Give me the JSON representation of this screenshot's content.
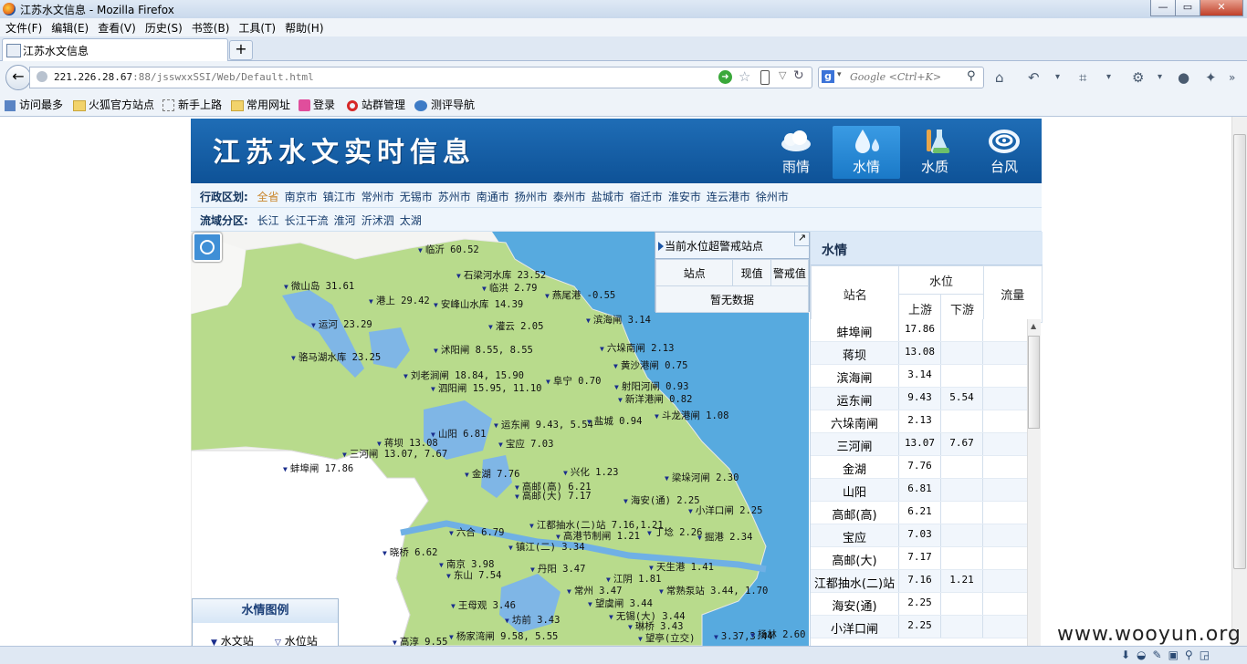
{
  "window": {
    "title": "江苏水文信息 - Mozilla Firefox",
    "min": "—",
    "max": "▭",
    "close": "✕"
  },
  "menu": [
    "文件(F)",
    "编辑(E)",
    "查看(V)",
    "历史(S)",
    "书签(B)",
    "工具(T)",
    "帮助(H)"
  ],
  "tab": {
    "title": "江苏水文信息",
    "new_tab": "+"
  },
  "nav": {
    "url_host": "221.226.28.67",
    "url_rest": ":88/jsswxxSSI/Web/Default.html",
    "search_placeholder": "Google <Ctrl+K>"
  },
  "bookmarks": [
    "访问最多",
    "火狐官方站点",
    "新手上路",
    "常用网址",
    "登录",
    "站群管理",
    "测评导航"
  ],
  "header": {
    "logo": "江苏水文实时信息",
    "nav": [
      {
        "label": "雨情",
        "icon": "cloud-icon"
      },
      {
        "label": "水情",
        "icon": "water-drop-icon"
      },
      {
        "label": "水质",
        "icon": "flask-icon"
      },
      {
        "label": "台风",
        "icon": "typhoon-icon"
      }
    ]
  },
  "region": {
    "label": "行政区划:",
    "items": [
      "全省",
      "南京市",
      "镇江市",
      "常州市",
      "无锡市",
      "苏州市",
      "南通市",
      "扬州市",
      "泰州市",
      "盐城市",
      "宿迁市",
      "淮安市",
      "连云港市",
      "徐州市"
    ]
  },
  "basin": {
    "label": "流域分区:",
    "items": [
      "长江",
      "长江干流",
      "淮河",
      "沂沭泗",
      "太湖"
    ]
  },
  "map_labels": [
    {
      "t": "临沂 60.52"
    },
    {
      "t": "石梁河水库 23.52"
    },
    {
      "t": "临洪 2.79"
    },
    {
      "t": "微山岛 31.61"
    },
    {
      "t": "港上 29.42"
    },
    {
      "t": "安峰山水库 14.39"
    },
    {
      "t": "燕尾港 -0.55"
    },
    {
      "t": "运河 23.29"
    },
    {
      "t": "灌云 2.05"
    },
    {
      "t": "滨海闸 3.14"
    },
    {
      "t": "沭阳闸 8.55, 8.55"
    },
    {
      "t": "六垛南闸 2.13"
    },
    {
      "t": "骆马湖水库 23.25"
    },
    {
      "t": "黄沙港闸 0.75"
    },
    {
      "t": "刘老涧闸 18.84, 15.90"
    },
    {
      "t": "阜宁 0.70"
    },
    {
      "t": "射阳河闸 0.93"
    },
    {
      "t": "泗阳闸 15.95, 11.10"
    },
    {
      "t": "新洋港闸 0.82"
    },
    {
      "t": "斗龙港闸 1.08"
    },
    {
      "t": "运东闸 9.43, 5.54"
    },
    {
      "t": "盐城 0.94"
    },
    {
      "t": "山阳 6.81"
    },
    {
      "t": "蒋坝 13.08"
    },
    {
      "t": "宝应 7.03"
    },
    {
      "t": "三河闸 13.07, 7.67"
    },
    {
      "t": "蚌埠闸 17.86"
    },
    {
      "t": "金湖 7.76"
    },
    {
      "t": "兴化 1.23"
    },
    {
      "t": "梁垛河闸 2.30"
    },
    {
      "t": "高邮(高) 6.21"
    },
    {
      "t": "高邮(大) 7.17"
    },
    {
      "t": "海安(通) 2.25"
    },
    {
      "t": "小洋口闸 2.25"
    },
    {
      "t": "江都抽水(二)站 7.16,1.21"
    },
    {
      "t": "丁埝 2.26"
    },
    {
      "t": "六合 6.79"
    },
    {
      "t": "高港节制闸 1.21"
    },
    {
      "t": "掘港 2.34"
    },
    {
      "t": "镇江(二) 3.34"
    },
    {
      "t": "晓桥 6.62"
    },
    {
      "t": "南京 3.98"
    },
    {
      "t": "丹阳 3.47"
    },
    {
      "t": "天生港 1.41"
    },
    {
      "t": "东山 7.54"
    },
    {
      "t": "江阴 1.81"
    },
    {
      "t": "常熟泵站 3.44, 1.70"
    },
    {
      "t": "常州 3.47"
    },
    {
      "t": "王母观 3.46"
    },
    {
      "t": "望虞闸 3.44"
    },
    {
      "t": "无锡(大) 3.44"
    },
    {
      "t": "坊前 3.43"
    },
    {
      "t": "琳桥 3.43"
    },
    {
      "t": "3.37,3.44"
    },
    {
      "t": "杨家湾闸 9.58, 5.55"
    },
    {
      "t": "望亭(立交)"
    },
    {
      "t": "高淳 9.55"
    },
    {
      "t": "杨林 2.60"
    }
  ],
  "warn_panel": {
    "title": "当前水位超警戒站点",
    "cols": [
      "站点",
      "现值",
      "警戒值"
    ],
    "empty": "暂无数据",
    "expand": "↗"
  },
  "legend": {
    "title": "水情图例",
    "items": [
      "水文站",
      "水位站"
    ]
  },
  "table": {
    "title": "水情",
    "h_name": "站名",
    "h_level": "水位",
    "h_up": "上游",
    "h_down": "下游",
    "h_flow": "流量",
    "rows": [
      {
        "name": "蚌埠闸",
        "up": "17.86",
        "down": ""
      },
      {
        "name": "蒋坝",
        "up": "13.08",
        "down": ""
      },
      {
        "name": "滨海闸",
        "up": "3.14",
        "down": ""
      },
      {
        "name": "运东闸",
        "up": "9.43",
        "down": "5.54"
      },
      {
        "name": "六垛南闸",
        "up": "2.13",
        "down": ""
      },
      {
        "name": "三河闸",
        "up": "13.07",
        "down": "7.67"
      },
      {
        "name": "金湖",
        "up": "7.76",
        "down": ""
      },
      {
        "name": "山阳",
        "up": "6.81",
        "down": ""
      },
      {
        "name": "高邮(高)",
        "up": "6.21",
        "down": ""
      },
      {
        "name": "宝应",
        "up": "7.03",
        "down": ""
      },
      {
        "name": "高邮(大)",
        "up": "7.17",
        "down": ""
      },
      {
        "name": "江都抽水(二)站",
        "up": "7.16",
        "down": "1.21"
      },
      {
        "name": "海安(通)",
        "up": "2.25",
        "down": ""
      },
      {
        "name": "小洋口闸",
        "up": "2.25",
        "down": ""
      }
    ]
  },
  "watermark": "www.wooyun.org",
  "colors": {
    "header": "#1f6db6",
    "land": "#b8db8c",
    "sea": "#57aadf",
    "lake": "#7fb6e6"
  }
}
